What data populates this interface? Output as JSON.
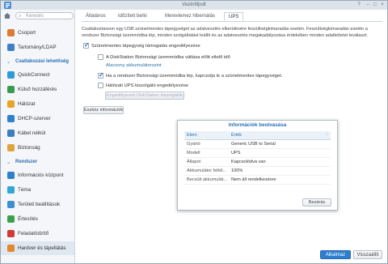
{
  "window": {
    "title": "Vezérlőpult"
  },
  "search": {
    "placeholder": "Keresés"
  },
  "sidebar": {
    "items": [
      {
        "label": "Csoport",
        "icon": "group-icon",
        "color": "#e07a30"
      },
      {
        "label": "Tartomány/LDAP",
        "icon": "domain-icon",
        "color": "#3f7fc9"
      },
      {
        "category": "Csatlakozási lehetőség"
      },
      {
        "label": "QuickConnect",
        "icon": "quickconnect-icon",
        "color": "#2f9ad8"
      },
      {
        "label": "Külső hozzáférés",
        "icon": "globe-icon",
        "color": "#3a9a4e"
      },
      {
        "label": "Hálózat",
        "icon": "network-icon",
        "color": "#e8a626"
      },
      {
        "label": "DHCP-szerver",
        "icon": "dhcp-icon",
        "color": "#2d7fd3"
      },
      {
        "label": "Kábel nélkül",
        "icon": "wireless-icon",
        "color": "#3a7fc0"
      },
      {
        "label": "Biztonság",
        "icon": "shield-icon",
        "color": "#e0a43a"
      },
      {
        "category": "Rendszer"
      },
      {
        "label": "Információs központ",
        "icon": "info-icon",
        "color": "#2f7fd0"
      },
      {
        "label": "Téma",
        "icon": "theme-icon",
        "color": "#2ea6d6"
      },
      {
        "label": "Területi beállítások",
        "icon": "regional-icon",
        "color": "#3c8fd1"
      },
      {
        "label": "Értesítés",
        "icon": "notification-icon",
        "color": "#3aa04a"
      },
      {
        "label": "Feladatödzítő",
        "icon": "scheduler-icon",
        "color": "#d23a3a"
      },
      {
        "label": "Hardver és tápellátás",
        "icon": "hardware-icon",
        "color": "#e08a2a"
      }
    ]
  },
  "tabs": [
    "Általános",
    "Időzített be/ki",
    "Merevlemez hibernálás",
    "UPS"
  ],
  "ups": {
    "description": "Csatlakoztasson egy USB szünetmentes tápegységet az adatvesztés elkerülésére feszültségkimaradás esetén. Feszültségkimaradás esetén a rendszer Biztonsági üzemmódba lép, minden szolgáltatást leállít és az adatvesztés megakadályozása érdekében minden adatkötetet leválaszt.",
    "enable_label": "Szünetmentes tápegység támogatás engedélyezése",
    "safemode_label": "A DiskStation Biztonsági üzemmódba váltása előtt eltelő idő",
    "battery_link": "Alacsony akkumulátorszint",
    "poweroff_label": "Ha a rendszer Biztonsági üzemmódba lép, kapcsolja le a szünetmentes tápegységet.",
    "network_label": "Hálózati UPS kiszolgáló engedélyezése",
    "permitted_button": "Engedélyezett DiskStation kiszolgálók",
    "device_info_button": "Eszköz információk"
  },
  "dialog": {
    "title": "Információk beolvasása",
    "col_item": "Elem",
    "col_value": "Érték",
    "rows": [
      {
        "k": "Gyártó",
        "v": "Generic USB to Serial"
      },
      {
        "k": "Modell",
        "v": "UPS"
      },
      {
        "k": "Állapot",
        "v": "Kapcsolódva van"
      },
      {
        "k": "Akkumulátor feltöl...",
        "v": "100%"
      },
      {
        "k": "Becsült akkumulát...",
        "v": "Nem áll rendelkezésre"
      }
    ],
    "close_button": "Bezárás"
  },
  "footer": {
    "apply": "Alkalmaz",
    "reset": "Visszaállít"
  }
}
